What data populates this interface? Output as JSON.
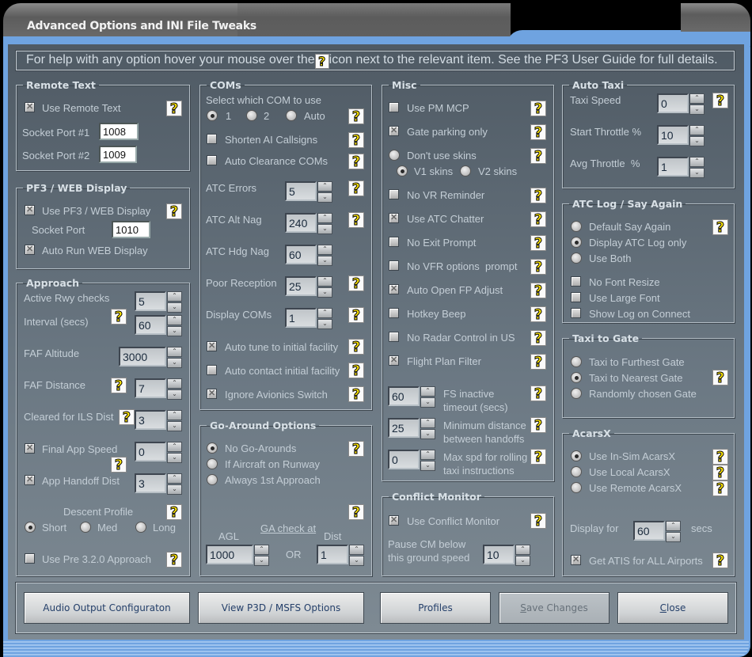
{
  "window": {
    "title": "Advanced Options and INI File Tweaks",
    "help_text_before": "For help with any option hover your mouse over the",
    "help_text_after": "icon next to the relevant item. See the PF3 User Guide for full details.",
    "help_icon": "question-mark-icon"
  },
  "remote_text": {
    "legend": "Remote Text",
    "use_remote_text": {
      "label": "Use Remote Text",
      "checked": true
    },
    "port1_label": "Socket Port #1",
    "port1_value": "1008",
    "port2_label": "Socket Port #2",
    "port2_value": "1009"
  },
  "web_display": {
    "legend": "PF3 / WEB Display",
    "use_web": {
      "label": "Use PF3 / WEB Display",
      "checked": true
    },
    "port_label": "Socket Port",
    "port_value": "1010",
    "auto_run": {
      "label": "Auto Run WEB Display",
      "checked": true
    }
  },
  "approach": {
    "legend": "Approach",
    "active_rwy_checks": {
      "label": "Active Rwy checks",
      "value": "5"
    },
    "interval": {
      "label": "Interval (secs)",
      "value": "60"
    },
    "faf_altitude": {
      "label": "FAF Altitude",
      "value": "3000"
    },
    "faf_distance": {
      "label": "FAF Distance",
      "value": "7"
    },
    "cleared_ils": {
      "label": "Cleared for ILS Dist",
      "value": "3"
    },
    "final_app_speed": {
      "label": "Final App Speed",
      "checked": true,
      "value": "0"
    },
    "app_handoff": {
      "label": "App Handoff Dist",
      "checked": true,
      "value": "3"
    },
    "descent_profile_label": "Descent Profile",
    "descent_options": [
      "Short",
      "Med",
      "Long"
    ],
    "descent_selected": "Short",
    "pre320": {
      "label": "Use Pre 3.2.0 Approach",
      "checked": false
    }
  },
  "coms": {
    "legend": "COMs",
    "select_label": "Select which COM to use",
    "com_options": [
      "1",
      "2",
      "Auto"
    ],
    "com_selected": "1",
    "shorten_ai": {
      "label": "Shorten AI Callsigns",
      "checked": false
    },
    "auto_clearance": {
      "label": "Auto Clearance COMs",
      "checked": false
    },
    "atc_errors": {
      "label": "ATC Errors",
      "value": "5"
    },
    "atc_alt_nag": {
      "label": "ATC Alt Nag",
      "value": "240"
    },
    "atc_hdg_nag": {
      "label": "ATC Hdg Nag",
      "value": "60"
    },
    "poor_reception": {
      "label": "Poor Reception",
      "value": "25"
    },
    "display_coms": {
      "label": "Display COMs",
      "value": "1"
    },
    "auto_tune": {
      "label": "Auto tune to initial facility",
      "checked": true
    },
    "auto_contact": {
      "label": "Auto contact initial facility",
      "checked": false
    },
    "ignore_avionics": {
      "label": "Ignore Avionics Switch",
      "checked": true
    }
  },
  "go_around": {
    "legend": "Go-Around Options",
    "options": [
      "No Go-Arounds",
      "If Aircraft on Runway",
      "Always 1st Approach"
    ],
    "selected": "No Go-Arounds",
    "ga_check_label": "GA check at",
    "agl_label": "AGL",
    "agl_value": "1000",
    "or_label": "OR",
    "dist_label": "Dist",
    "dist_value": "1"
  },
  "misc": {
    "legend": "Misc",
    "use_pm_mcp": {
      "label": "Use PM MCP",
      "checked": false
    },
    "gate_parking": {
      "label": "Gate parking only",
      "checked": true
    },
    "skins": {
      "dont_use": "Don't use skins",
      "v1": "V1 skins",
      "v2": "V2 skins",
      "selected": "V1 skins"
    },
    "no_vr": {
      "label": "No VR Reminder",
      "checked": false
    },
    "atc_chatter": {
      "label": "Use ATC Chatter",
      "checked": true
    },
    "no_exit": {
      "label": "No Exit Prompt",
      "checked": false
    },
    "no_vfr": {
      "label": "No VFR options  prompt",
      "checked": false
    },
    "auto_open_fp": {
      "label": "Auto Open FP Adjust",
      "checked": true
    },
    "hotkey_beep": {
      "label": "Hotkey Beep",
      "checked": false
    },
    "no_radar": {
      "label": "No Radar Control in US",
      "checked": false
    },
    "fp_filter": {
      "label": "Flight Plan Filter",
      "checked": true
    },
    "fs_inactive": {
      "label1": "FS inactive",
      "label2": "timeout (secs)",
      "value": "60"
    },
    "min_distance": {
      "label1": "Minimum distance",
      "label2": "between handoffs",
      "value": "25"
    },
    "max_spd": {
      "label1": "Max spd for rolling",
      "label2": "taxi instructions",
      "value": "0"
    }
  },
  "conflict_monitor": {
    "legend": "Conflict Monitor",
    "use_cm": {
      "label": "Use Conflict Monitor",
      "checked": true
    },
    "pause_label1": "Pause CM below",
    "pause_label2": "this ground speed",
    "pause_value": "10"
  },
  "auto_taxi": {
    "legend": "Auto Taxi",
    "taxi_speed": {
      "label": "Taxi Speed",
      "value": "0"
    },
    "start_throttle": {
      "label": "Start Throttle %",
      "value": "10"
    },
    "avg_throttle": {
      "label": "Avg Throttle  %",
      "value": "1"
    }
  },
  "atc_log": {
    "legend": "ATC Log / Say Again",
    "options": [
      "Default Say Again",
      "Display ATC Log only",
      "Use Both"
    ],
    "selected": "Display ATC Log only",
    "no_font_resize": {
      "label": "No Font Resize",
      "checked": false
    },
    "large_font": {
      "label": "Use Large Font",
      "checked": false
    },
    "show_log": {
      "label": "Show Log on Connect",
      "checked": false
    }
  },
  "taxi_gate": {
    "legend": "Taxi to Gate",
    "options": [
      "Taxi to Furthest Gate",
      "Taxi to Nearest Gate",
      "Randomly chosen Gate"
    ],
    "selected": "Taxi to Nearest Gate"
  },
  "acarsx": {
    "legend": "AcarsX",
    "options": [
      "Use In-Sim AcarsX",
      "Use Local AcarsX",
      "Use Remote AcarsX"
    ],
    "selected": "Use In-Sim AcarsX",
    "display_for_label": "Display for",
    "display_value": "60",
    "secs_label": "secs",
    "get_atis": {
      "label": "Get ATIS for ALL Airports",
      "checked": true
    }
  },
  "buttons": {
    "audio": "Audio Output Configuraton",
    "view_options": "View P3D / MSFS Options",
    "profiles": "Profiles",
    "save_first": "S",
    "save_rest": "ave Changes",
    "close_first": "C",
    "close_rest": "lose"
  }
}
